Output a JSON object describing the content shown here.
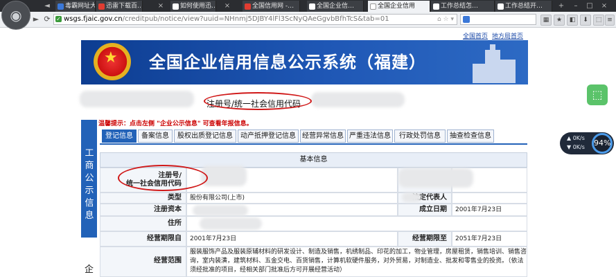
{
  "browser": {
    "tabs": [
      {
        "title": "毒霸网址大…",
        "color": "#3b78d8"
      },
      {
        "title": "迅雷下载百…",
        "color": "#e03c31"
      },
      {
        "title": "如何使用迅…",
        "color": "#ffffff"
      },
      {
        "title": "全国信用网 -…",
        "color": "#e03c31"
      },
      {
        "title": "全国企业信…",
        "color": "#ffffff"
      },
      {
        "title": "全国企业信用",
        "color": "#ffffff",
        "active": true
      },
      {
        "title": "工作总结怎…",
        "color": "#ffffff"
      },
      {
        "title": "工作总结开…",
        "color": "#ffffff"
      }
    ],
    "url_host": "wsgs.fjaic.gov.cn",
    "url_path": "/creditpub/notice/view?uuid=NHnmj5DJBY4lFl3ScNyQAeGgvbBfhTcS&tab=01",
    "nav_icons": [
      "back-arrow-icon",
      "forward-arrow-icon",
      "refresh-icon",
      "home-icon"
    ]
  },
  "page": {
    "top_links": [
      "全国首页",
      "地方局首页"
    ],
    "banner_title": "全国企业信用信息公示系统（福建）",
    "reg_title": "注册号/统一社会信用代码",
    "notice": "温馨提示：点击左侧 \"企业公示信息\" 可查看年报信息。",
    "sidebar_label": "工商公示信息",
    "sidebar_label2": "企",
    "tabs": [
      "登记信息",
      "备案信息",
      "股权出质登记信息",
      "动产抵押登记信息",
      "经营异常信息",
      "严重违法信息",
      "行政处罚信息",
      "抽查检查信息"
    ],
    "section_title": "基本信息",
    "rows": [
      {
        "l1": "注册号/\n统一社会信用代码",
        "v1": "",
        "l2": "名称",
        "v2": ""
      },
      {
        "l1": "类型",
        "v1": "股份有限公司(上市)",
        "l2": "法定代表人",
        "v2": ""
      },
      {
        "l1": "注册资本",
        "v1": "",
        "l2": "成立日期",
        "v2": "2001年7月23日"
      },
      {
        "l1": "住所",
        "v1": "",
        "l2": "",
        "v2": ""
      },
      {
        "l1": "经营期限自",
        "v1": "2001年7月23日",
        "l2": "经营期限至",
        "v2": "2051年7月23日"
      },
      {
        "l1": "经营范围",
        "v1": "服装服饰产品及服装原辅材料的研发设计、制造及销售，机绣制品、印花的加工，物业管理，房屋租赁，销售培训、销售咨询，室内装潢，建筑材料、五金交电、百货销售，计算机软硬件服务，对外贸易，对制造业、批发和零售业的投资。（依法须经批准的项目，经相关部门批准后方可开展经营活动）",
        "l2": "",
        "v2": ""
      }
    ]
  },
  "overlay": {
    "speed_up": "0K/s",
    "speed_down": "0K/s",
    "memory": "94%"
  }
}
